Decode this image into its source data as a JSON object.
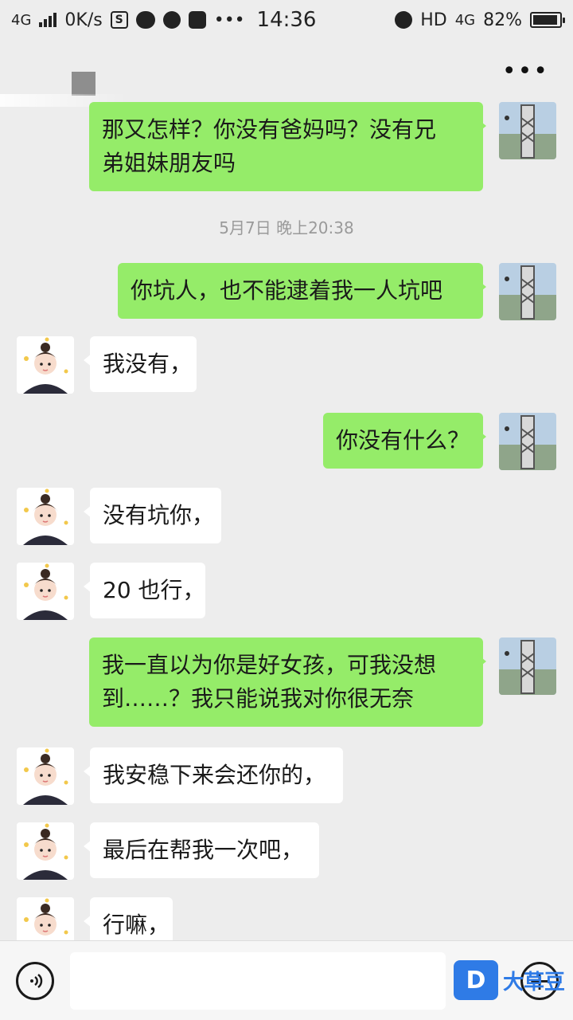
{
  "status_bar": {
    "network": "4G",
    "speed": "0K/s",
    "time": "14:36",
    "hd": "HD",
    "network_right": "4G",
    "battery": "82%",
    "battery_level": 0.82
  },
  "header": {
    "more": "•••"
  },
  "timestamp": "5月7日 晚上20:38",
  "messages": [
    {
      "side": "me",
      "lines": [
        "那又怎样？你没有爸妈吗？没有兄",
        "弟姐妹朋友吗"
      ]
    },
    {
      "side": "me",
      "lines": [
        "你坑人，也不能逮着我一人坑吧"
      ]
    },
    {
      "side": "other",
      "lines": [
        "我没有，"
      ]
    },
    {
      "side": "me",
      "lines": [
        "你没有什么？"
      ]
    },
    {
      "side": "other",
      "lines": [
        "没有坑你，"
      ]
    },
    {
      "side": "other",
      "lines": [
        "20 也行，"
      ]
    },
    {
      "side": "me",
      "lines": [
        "我一直以为你是好女孩，可我没想",
        "到……？我只能说我对你很无奈"
      ]
    },
    {
      "side": "other",
      "lines": [
        "我安稳下来会还你的，"
      ]
    },
    {
      "side": "other",
      "lines": [
        "最后在帮我一次吧，"
      ]
    },
    {
      "side": "other",
      "lines": [
        "行嘛，"
      ]
    }
  ],
  "input": {
    "value": "",
    "placeholder": ""
  },
  "watermark": {
    "logo": "D",
    "text": "大草豆"
  },
  "colors": {
    "bubble_me": "#95ec69",
    "bubble_other": "#ffffff",
    "background": "#ededed"
  }
}
